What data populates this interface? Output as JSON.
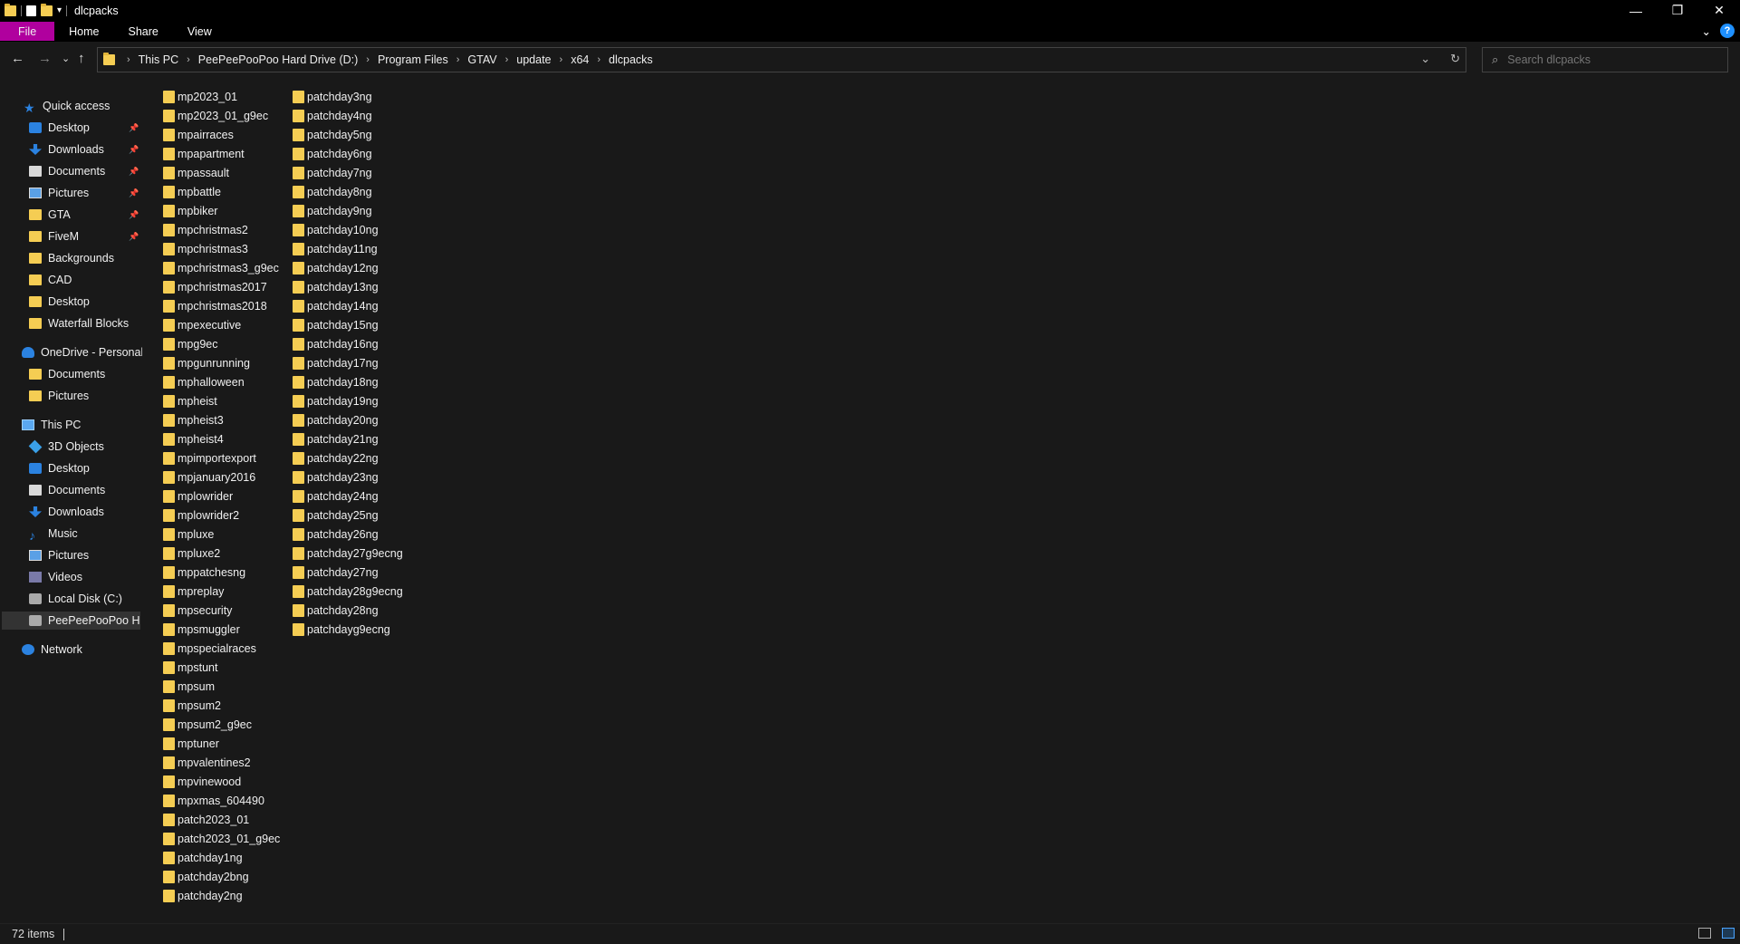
{
  "window": {
    "title": "dlcpacks",
    "minimize": "—",
    "maximize": "❐",
    "close": "✕"
  },
  "ribbon": {
    "tabs": [
      "File",
      "Home",
      "Share",
      "View"
    ],
    "expand": "⌄",
    "help": "?"
  },
  "nav": {
    "back": "←",
    "forward": "→",
    "recent": "⌄",
    "up": "↑",
    "dropdown": "⌄",
    "refresh": "↻"
  },
  "address": {
    "crumbs": [
      "This PC",
      "PeePeePooPoo Hard Drive (D:)",
      "Program Files",
      "GTAV",
      "update",
      "x64",
      "dlcpacks"
    ]
  },
  "search": {
    "placeholder": "Search dlcpacks"
  },
  "sidebar": {
    "quick_access": "Quick access",
    "quick_items": [
      "Desktop",
      "Downloads",
      "Documents",
      "Pictures",
      "GTA",
      "FiveM",
      "Backgrounds",
      "CAD",
      "Desktop",
      "Waterfall Blocks"
    ],
    "onedrive": "OneDrive - Personal",
    "onedrive_items": [
      "Documents",
      "Pictures"
    ],
    "this_pc": "This PC",
    "pc_items": [
      "3D Objects",
      "Desktop",
      "Documents",
      "Downloads",
      "Music",
      "Pictures",
      "Videos",
      "Local Disk (C:)",
      "PeePeePooPoo Hard Drive (D:)"
    ],
    "network": "Network"
  },
  "files": {
    "col1": [
      "mp2023_01",
      "mp2023_01_g9ec",
      "mpairraces",
      "mpapartment",
      "mpassault",
      "mpbattle",
      "mpbiker",
      "mpchristmas2",
      "mpchristmas3",
      "mpchristmas3_g9ec",
      "mpchristmas2017",
      "mpchristmas2018",
      "mpexecutive",
      "mpg9ec",
      "mpgunrunning",
      "mphalloween",
      "mpheist",
      "mpheist3",
      "mpheist4",
      "mpimportexport",
      "mpjanuary2016",
      "mplowrider",
      "mplowrider2",
      "mpluxe",
      "mpluxe2",
      "mppatchesng",
      "mpreplay",
      "mpsecurity",
      "mpsmuggler",
      "mpspecialraces",
      "mpstunt",
      "mpsum",
      "mpsum2",
      "mpsum2_g9ec",
      "mptuner",
      "mpvalentines2",
      "mpvinewood",
      "mpxmas_604490",
      "patch2023_01",
      "patch2023_01_g9ec",
      "patchday1ng",
      "patchday2bng",
      "patchday2ng"
    ],
    "col2": [
      "patchday3ng",
      "patchday4ng",
      "patchday5ng",
      "patchday6ng",
      "patchday7ng",
      "patchday8ng",
      "patchday9ng",
      "patchday10ng",
      "patchday11ng",
      "patchday12ng",
      "patchday13ng",
      "patchday14ng",
      "patchday15ng",
      "patchday16ng",
      "patchday17ng",
      "patchday18ng",
      "patchday19ng",
      "patchday20ng",
      "patchday21ng",
      "patchday22ng",
      "patchday23ng",
      "patchday24ng",
      "patchday25ng",
      "patchday26ng",
      "patchday27g9ecng",
      "patchday27ng",
      "patchday28g9ecng",
      "patchday28ng",
      "patchdayg9ecng"
    ]
  },
  "status": {
    "count": "72 items"
  }
}
